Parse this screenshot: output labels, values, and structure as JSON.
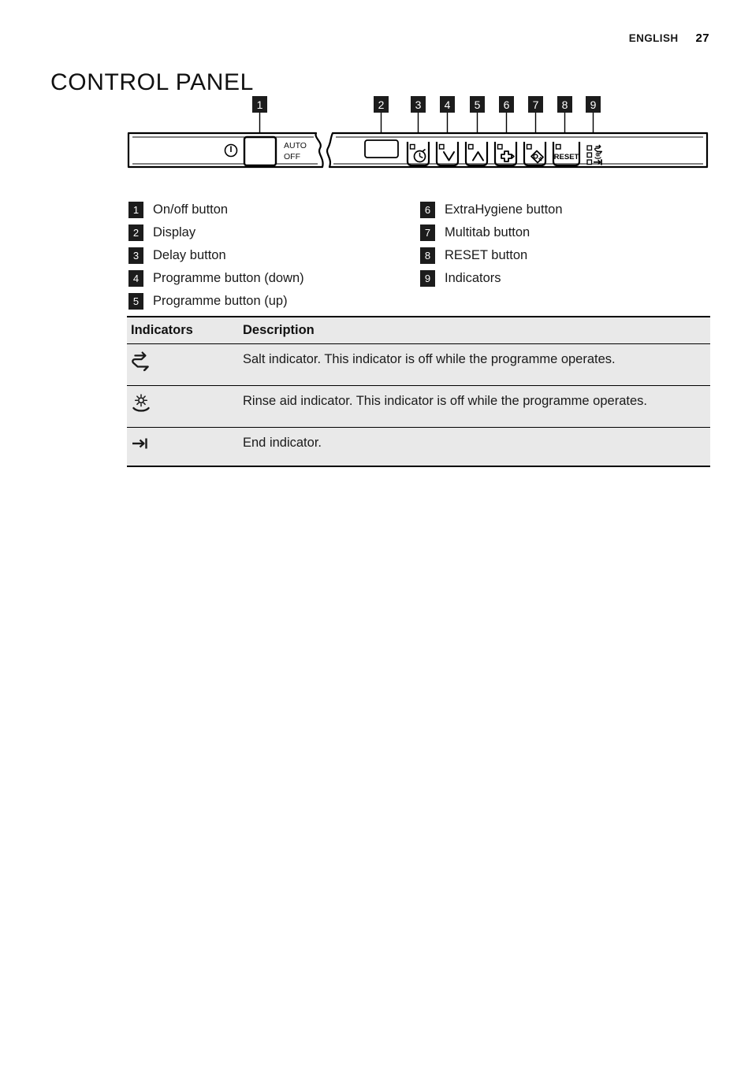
{
  "header": {
    "language": "ENGLISH",
    "page_number": "27"
  },
  "title": "CONTROL PANEL",
  "diagram": {
    "name": "control-panel-diagram",
    "callout_numbers": [
      "1",
      "2",
      "3",
      "4",
      "5",
      "6",
      "7",
      "8",
      "9"
    ],
    "power_symbol_label": "ⓞ",
    "auto_label": "AUTO",
    "off_label": "OFF",
    "reset_label": "RESET",
    "icons": {
      "delay": "clock-icon",
      "programme_down": "chevron-down-icon",
      "programme_up": "chevron-up-icon",
      "extrahygiene": "plus-shield-icon",
      "multitab": "tablet-icon",
      "reset": "reset-label-icon",
      "salt_indicator": "salt-icon",
      "rinse_aid_indicator": "rinse-aid-icon",
      "end_indicator": "end-arrow-icon"
    }
  },
  "legend": {
    "left": [
      {
        "num": "1",
        "label": "On/off button"
      },
      {
        "num": "2",
        "label": "Display"
      },
      {
        "num": "3",
        "label": "Delay button"
      },
      {
        "num": "4",
        "label": "Programme button (down)"
      },
      {
        "num": "5",
        "label": "Programme button (up)"
      }
    ],
    "right": [
      {
        "num": "6",
        "label": "ExtraHygiene button"
      },
      {
        "num": "7",
        "label": "Multitab button"
      },
      {
        "num": "8",
        "label": "RESET button"
      },
      {
        "num": "9",
        "label": "Indicators"
      }
    ]
  },
  "indicators_table": {
    "headers": {
      "indicators": "Indicators",
      "description": "Description"
    },
    "rows": [
      {
        "icon": "salt-icon",
        "description": "Salt indicator. This indicator is off while the programme operates."
      },
      {
        "icon": "rinse-aid-icon",
        "description": "Rinse aid indicator. This indicator is off while the programme operates."
      },
      {
        "icon": "end-arrow-icon",
        "description": "End indicator."
      }
    ]
  },
  "colors": {
    "badge_background": "#1c1c1c",
    "badge_text": "#ffffff",
    "table_background": "#e9e9e9",
    "rule": "#000000",
    "text": "#1a1a1a"
  }
}
